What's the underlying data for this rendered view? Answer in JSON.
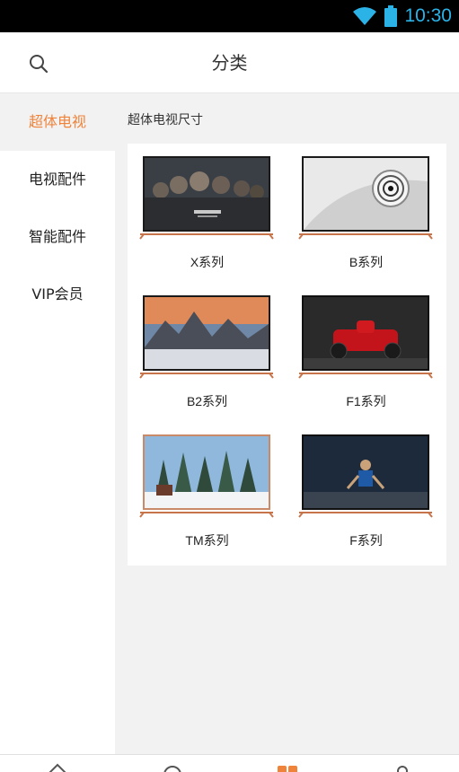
{
  "status_bar": {
    "time": "10:30",
    "color": "#2bb3e8"
  },
  "header": {
    "title": "分类",
    "search_icon": "search-icon"
  },
  "sidebar": {
    "items": [
      {
        "label": "超体电视",
        "active": true
      },
      {
        "label": "电视配件",
        "active": false
      },
      {
        "label": "智能配件",
        "active": false
      },
      {
        "label": "VIP会员",
        "active": false
      }
    ],
    "accent_color": "#f0833a"
  },
  "content": {
    "section_title": "超体电视尺寸",
    "products": [
      {
        "name": "X系列",
        "image": "x-series-tv-image"
      },
      {
        "name": "B系列",
        "image": "b-series-tv-image"
      },
      {
        "name": "B2系列",
        "image": "b2-series-tv-image"
      },
      {
        "name": "F1系列",
        "image": "f1-series-tv-image"
      },
      {
        "name": "TM系列",
        "image": "tm-series-tv-image"
      },
      {
        "name": "F系列",
        "image": "f-series-tv-image"
      }
    ]
  },
  "bottom_nav": {
    "items": [
      {
        "icon": "home-icon"
      },
      {
        "icon": "discover-icon"
      },
      {
        "icon": "category-icon",
        "active": true
      },
      {
        "icon": "profile-icon"
      }
    ]
  }
}
